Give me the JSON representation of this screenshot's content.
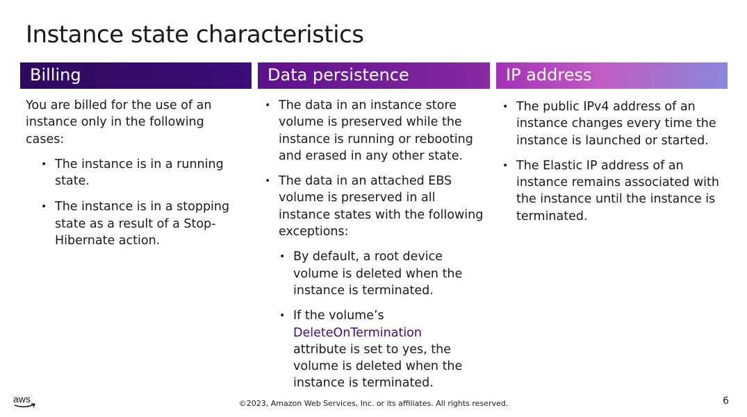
{
  "slide": {
    "title": "Instance state characteristics",
    "page_number": "6",
    "footer": "©2023, Amazon Web Services, Inc. or its affiliates. All rights reserved.",
    "logo_text": "aws"
  },
  "columns": {
    "billing": {
      "header": "Billing",
      "intro": "You are billed for the use of an instance only in the following cases:",
      "bullets": [
        "The instance is in a running state.",
        "The instance is in a stopping state as a result of a Stop-Hibernate action."
      ]
    },
    "data": {
      "header": "Data persistence",
      "bullets": [
        "The data in an instance store volume is preserved while the instance is running or rebooting and erased in any other state.",
        "The data in an attached EBS volume is preserved in all instance states with the following exceptions:"
      ],
      "sub_bullets": [
        "By default, a root device volume is deleted when the instance is terminated."
      ],
      "sub_bullet_2": {
        "prefix": "If the volume’s",
        "code": "DeleteOnTermination",
        "suffix": "attribute is set to yes, the volume is deleted when the instance is terminated."
      }
    },
    "ip": {
      "header": "IP address",
      "bullets": [
        "The public IPv4 address of an instance changes every time the instance is launched or started.",
        "The Elastic IP address of an instance remains associated with the instance until the instance is terminated."
      ]
    }
  },
  "colors": {
    "title": "#16191f",
    "billing_header": "#2e0a5e",
    "data_header": "#7a2099",
    "ip_header": "#b04cbd",
    "code_text": "#3b0e78"
  }
}
